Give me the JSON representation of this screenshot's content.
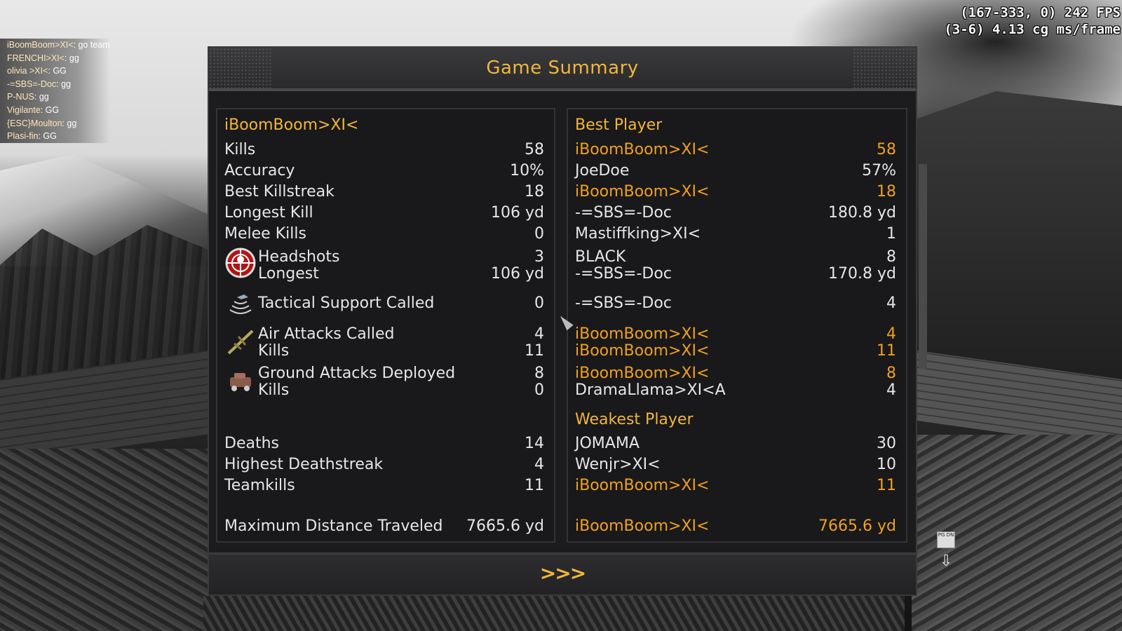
{
  "perf": {
    "line1": "(167-333, 0) 242 FPS",
    "line2": "(3-6) 4.13 cg ms/frame"
  },
  "chat": [
    {
      "name": "iBoomBoom>XI<",
      "msg": ": go team"
    },
    {
      "name": "FRENCHI>XI<",
      "msg": ": gg"
    },
    {
      "name": "olivia >XI<",
      "msg": ": GG"
    },
    {
      "name": "-=SBS=-Doc",
      "msg": ": gg"
    },
    {
      "name": "P-NUS",
      "msg": ": gg"
    },
    {
      "name": "Vigilante",
      "msg": ": GG"
    },
    {
      "name": "{ESC}Moulton",
      "msg": ": gg"
    },
    {
      "name": "Plasi-fin",
      "msg": ": GG"
    }
  ],
  "title": "Game Summary",
  "left": {
    "player": "iBoomBoom>XI<",
    "kills": {
      "label": "Kills",
      "value": "58"
    },
    "accuracy": {
      "label": "Accuracy",
      "value": "10%"
    },
    "killstreak": {
      "label": "Best Killstreak",
      "value": "18"
    },
    "longest_kill": {
      "label": "Longest Kill",
      "value": "106 yd"
    },
    "melee": {
      "label": "Melee Kills",
      "value": "0"
    },
    "headshots": {
      "label": "Headshots",
      "value": "3"
    },
    "hs_longest": {
      "label": "Longest",
      "value": "106 yd"
    },
    "tactical": {
      "label": "Tactical Support Called",
      "value": "0"
    },
    "air": {
      "label": "Air Attacks Called",
      "value": "4"
    },
    "air_kills": {
      "label": "Kills",
      "value": "11"
    },
    "ground": {
      "label": "Ground Attacks Deployed",
      "value": "8"
    },
    "ground_kills": {
      "label": "Kills",
      "value": "0"
    },
    "deaths": {
      "label": "Deaths",
      "value": "14"
    },
    "deathstreak": {
      "label": "Highest Deathstreak",
      "value": "4"
    },
    "teamkills": {
      "label": "Teamkills",
      "value": "11"
    },
    "distance": {
      "label": "Maximum Distance Traveled",
      "value": "7665.6 yd"
    }
  },
  "right": {
    "best_heading": "Best Player",
    "kills": {
      "name": "iBoomBoom>XI<",
      "value": "58"
    },
    "accuracy": {
      "name": "JoeDoe",
      "value": "57%"
    },
    "killstreak": {
      "name": "iBoomBoom>XI<",
      "value": "18"
    },
    "longest_kill": {
      "name": "-=SBS=-Doc",
      "value": "180.8 yd"
    },
    "melee": {
      "name": "Mastiffking>XI<",
      "value": "1"
    },
    "headshots": {
      "name": "BLACK",
      "value": "8"
    },
    "hs_longest": {
      "name": "-=SBS=-Doc",
      "value": "170.8 yd"
    },
    "tactical": {
      "name": "-=SBS=-Doc",
      "value": "4"
    },
    "air": {
      "name": "iBoomBoom>XI<",
      "value": "4"
    },
    "air_kills": {
      "name": "iBoomBoom>XI<",
      "value": "11"
    },
    "ground": {
      "name": "iBoomBoom>XI<",
      "value": "8"
    },
    "ground_kills": {
      "name": "DramaLlama>XI<A",
      "value": "4"
    },
    "weakest_heading": "Weakest Player",
    "deaths": {
      "name": "JOMAMA",
      "value": "30"
    },
    "deathstreak": {
      "name": "Wenjr>XI<",
      "value": "10"
    },
    "teamkills": {
      "name": "iBoomBoom>XI<",
      "value": "11"
    },
    "distance": {
      "name": "iBoomBoom>XI<",
      "value": "7665.6 yd"
    }
  },
  "next_label": ">>>",
  "pgdn_label": "PG DN",
  "colors": {
    "accent": "#f2b63c",
    "highlight": "#f0a020",
    "text": "#e6e6e6"
  }
}
